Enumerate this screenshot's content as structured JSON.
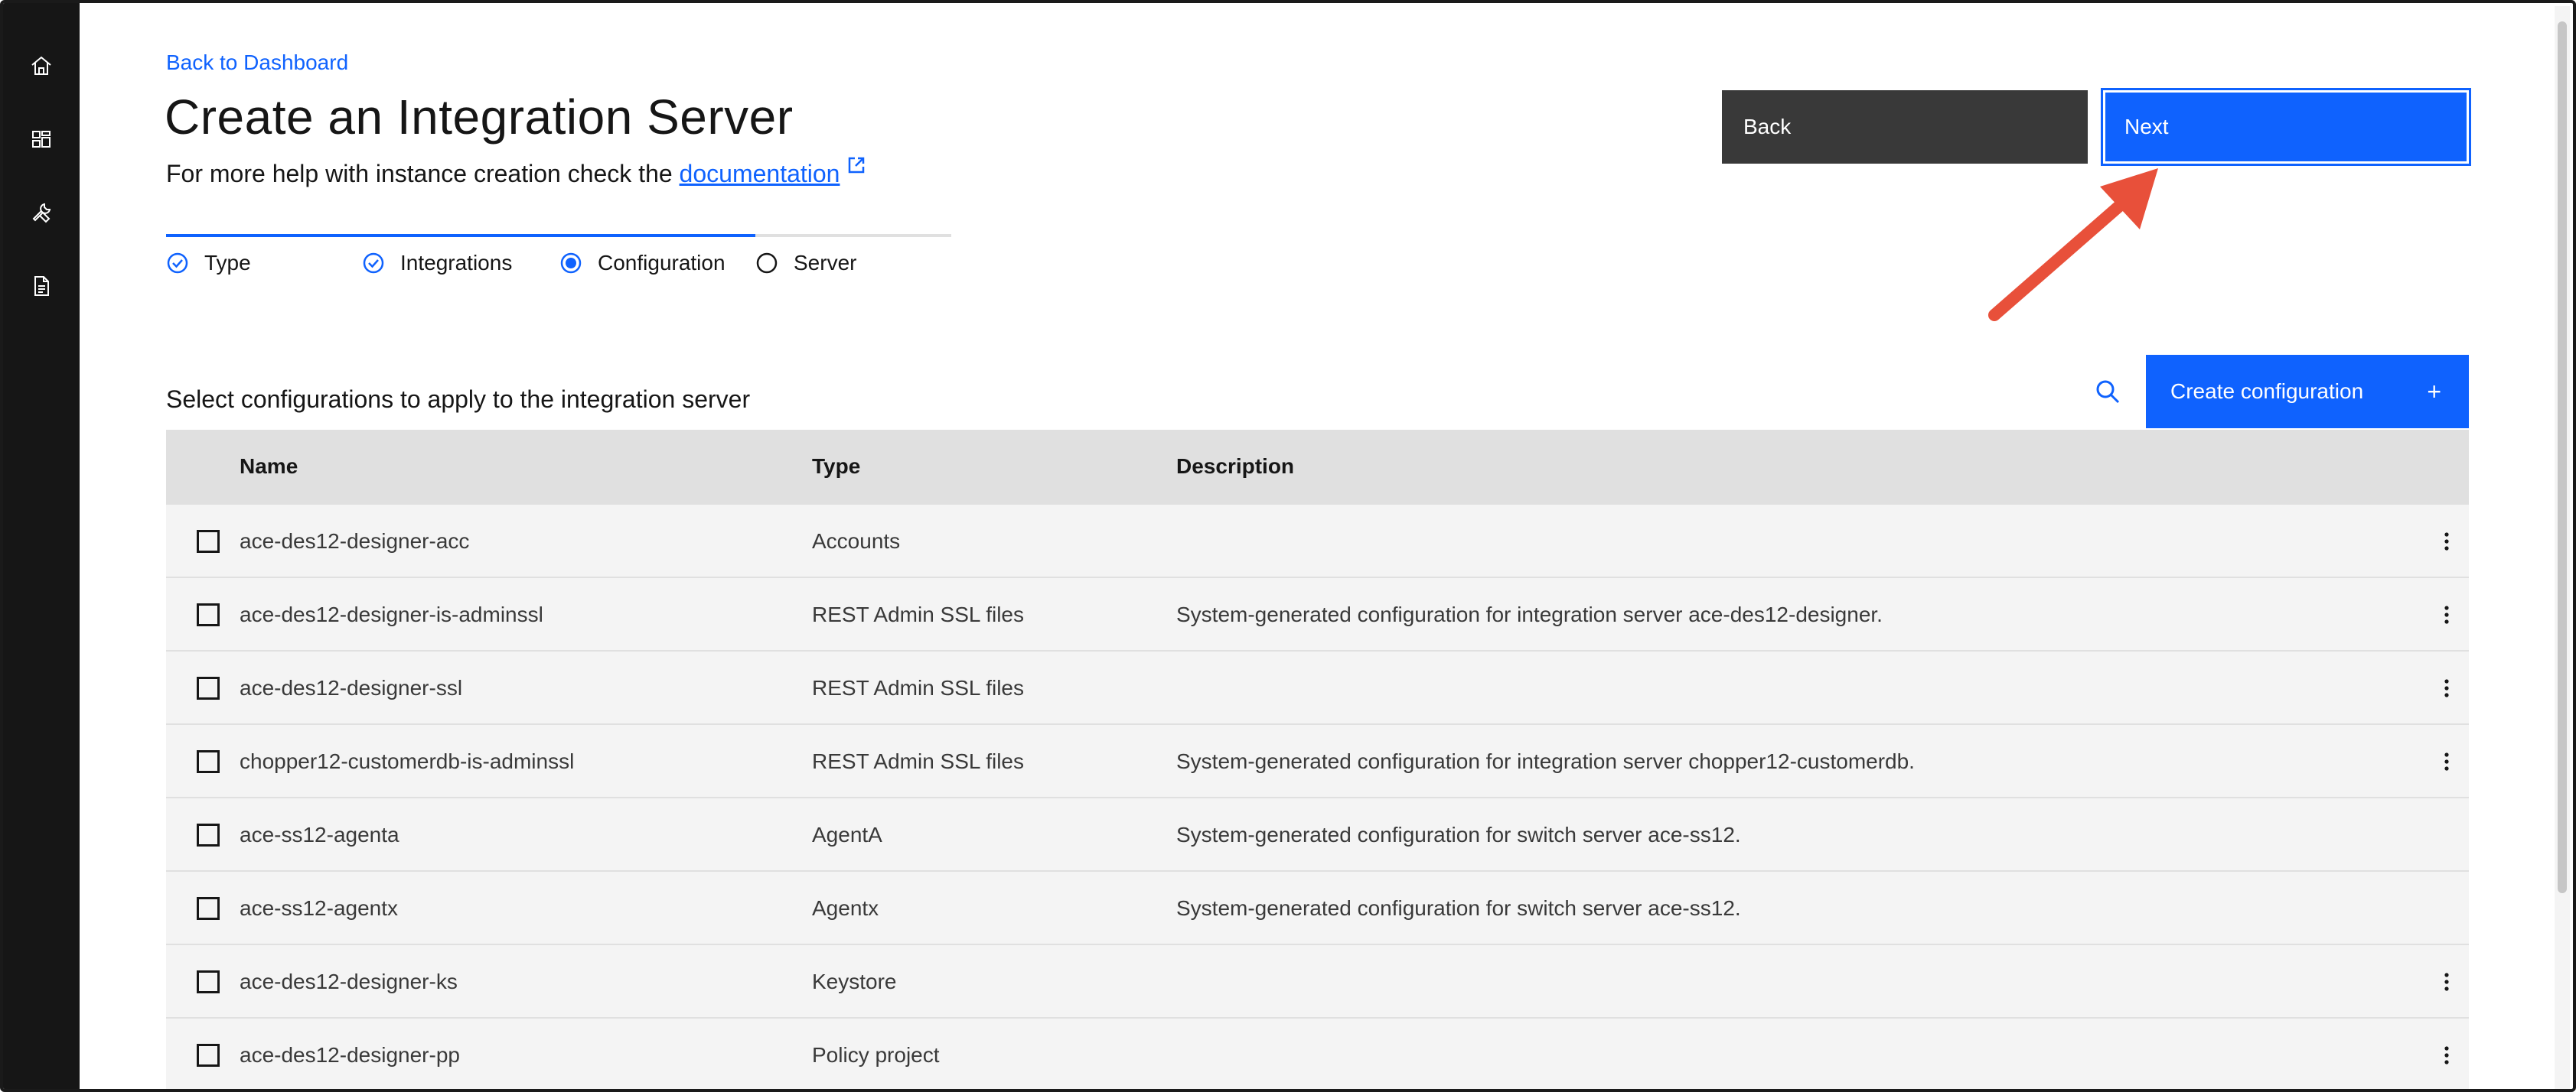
{
  "nav": {
    "back_link": "Back to Dashboard"
  },
  "page": {
    "title": "Create an Integration Server",
    "subtitle_prefix": "For more help with instance creation check the",
    "doc_link": "documentation"
  },
  "progress": {
    "completed_fraction": 0.75,
    "steps": [
      {
        "label": "Type",
        "state": "complete"
      },
      {
        "label": "Integrations",
        "state": "complete"
      },
      {
        "label": "Configuration",
        "state": "current"
      },
      {
        "label": "Server",
        "state": "incomplete"
      }
    ]
  },
  "actions": {
    "back_label": "Back",
    "next_label": "Next",
    "create_label": "Create configuration",
    "create_icon": "plus-icon",
    "search_icon": "search-icon"
  },
  "section": {
    "label": "Select configurations to apply to the integration server"
  },
  "table": {
    "headers": {
      "name": "Name",
      "type": "Type",
      "description": "Description"
    },
    "rows": [
      {
        "name": "ace-des12-designer-acc",
        "type": "Accounts",
        "description": "",
        "menu": true
      },
      {
        "name": "ace-des12-designer-is-adminssl",
        "type": "REST Admin SSL files",
        "description": "System-generated configuration for integration server ace-des12-designer.",
        "menu": true
      },
      {
        "name": "ace-des12-designer-ssl",
        "type": "REST Admin SSL files",
        "description": "",
        "menu": true
      },
      {
        "name": "chopper12-customerdb-is-adminssl",
        "type": "REST Admin SSL files",
        "description": "System-generated configuration for integration server chopper12-customerdb.",
        "menu": true
      },
      {
        "name": "ace-ss12-agenta",
        "type": "AgentA",
        "description": "System-generated configuration for switch server ace-ss12.",
        "menu": false
      },
      {
        "name": "ace-ss12-agentx",
        "type": "Agentx",
        "description": "System-generated configuration for switch server ace-ss12.",
        "menu": false
      },
      {
        "name": "ace-des12-designer-ks",
        "type": "Keystore",
        "description": "",
        "menu": true
      },
      {
        "name": "ace-des12-designer-pp",
        "type": "Policy project",
        "description": "",
        "menu": true
      }
    ]
  },
  "sidebar": {
    "icons": [
      "home-icon",
      "dashboard-icon",
      "tools-icon",
      "document-icon"
    ]
  },
  "colors": {
    "primary": "#0f62fe",
    "secondary_button": "#393939",
    "rail": "#161616",
    "annotation_arrow": "#e8503a"
  }
}
